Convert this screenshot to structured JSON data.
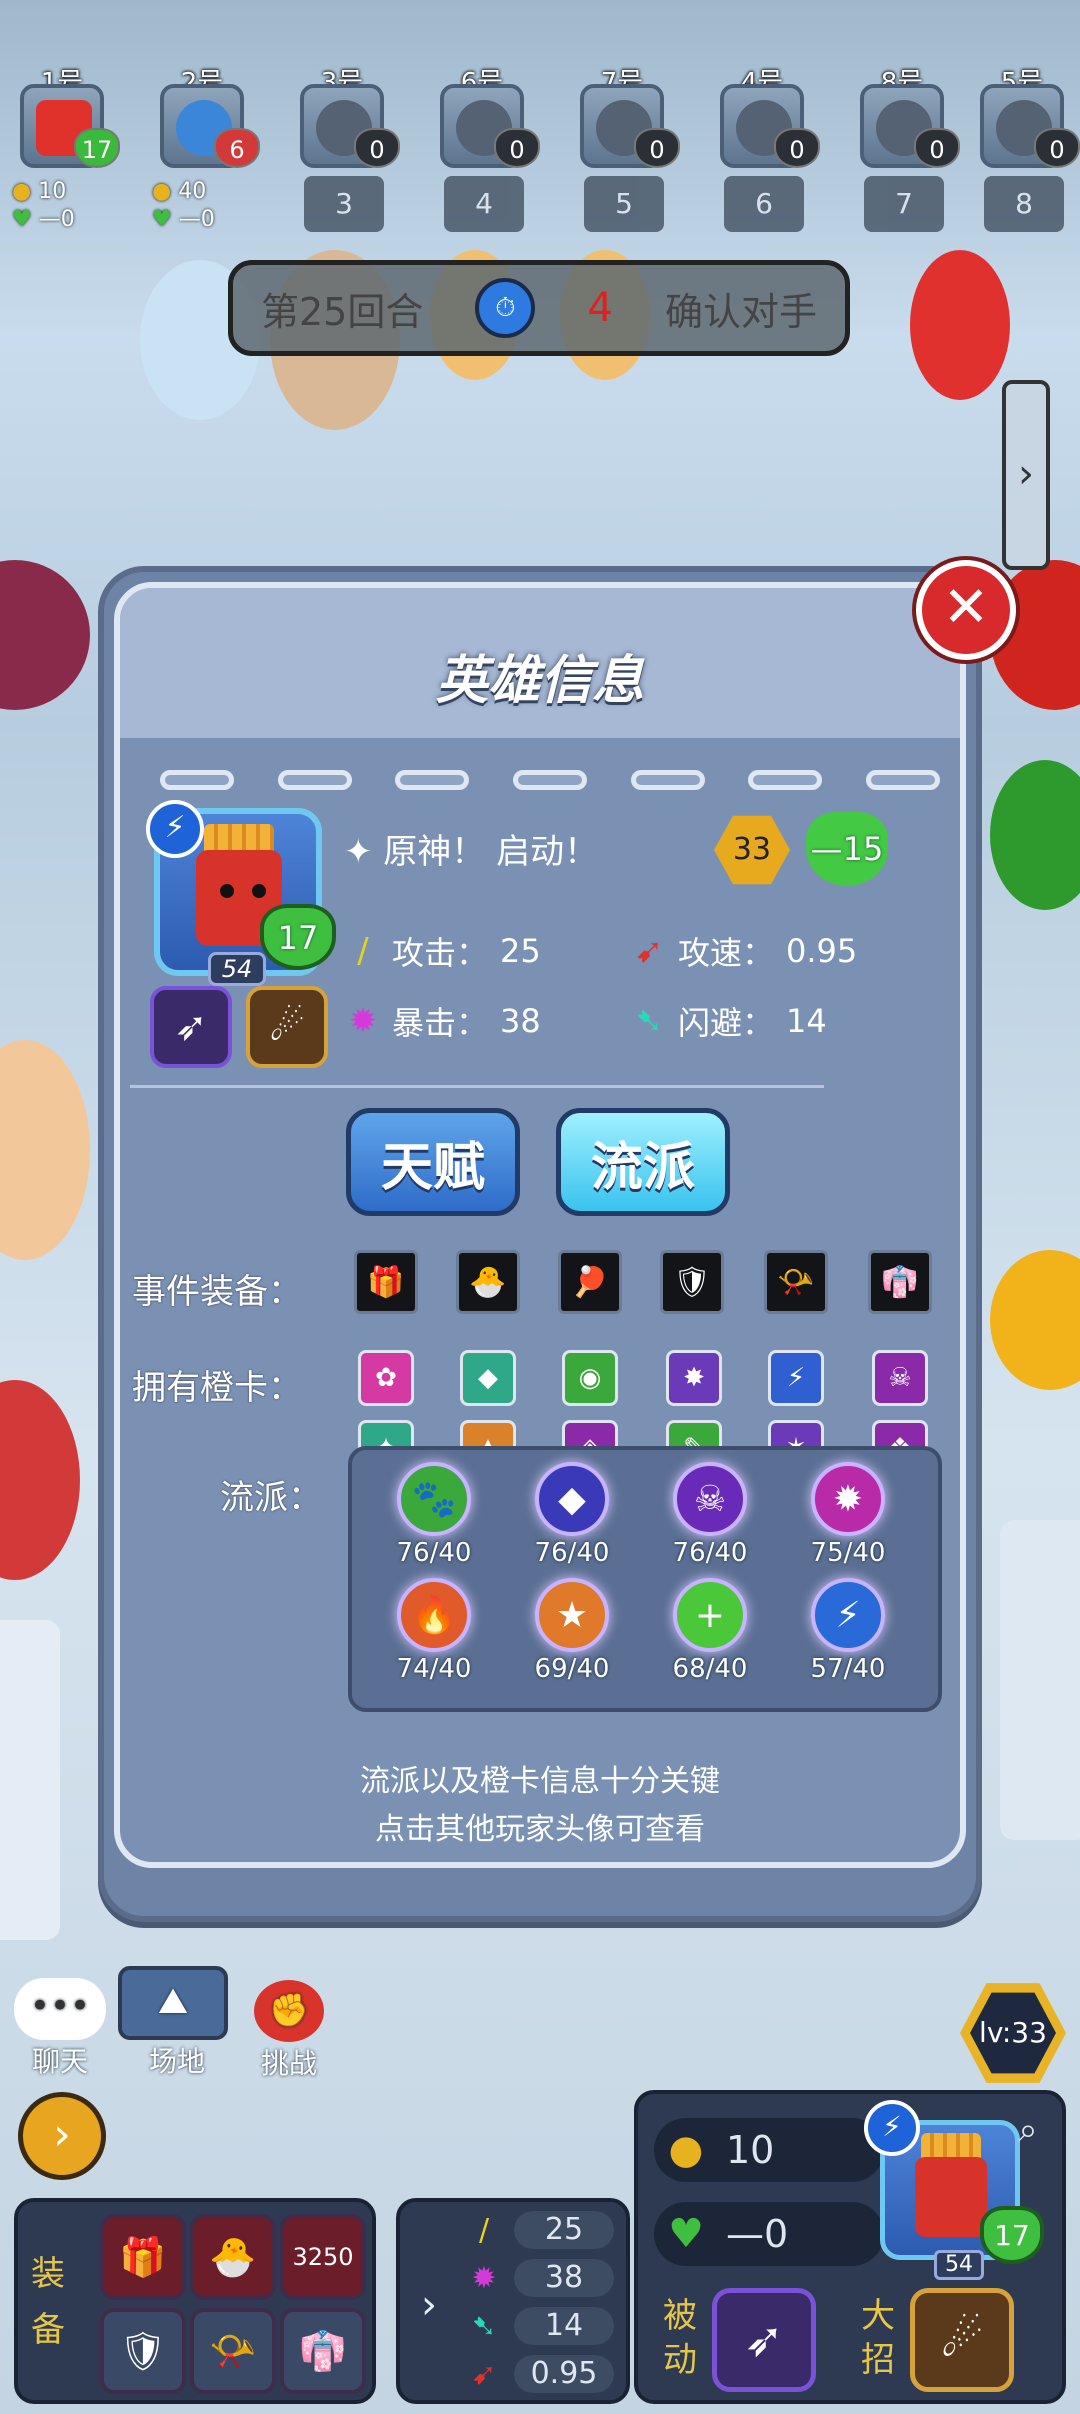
{
  "players": [
    {
      "num": "1号",
      "hp": "17",
      "rank": "",
      "gold": "10",
      "hpdelta": "—0",
      "avatar": "fries",
      "heart": "green"
    },
    {
      "num": "2号",
      "hp": "6",
      "rank": "",
      "gold": "40",
      "hpdelta": "—0",
      "avatar": "blue",
      "heart": "red"
    },
    {
      "num": "3号",
      "hp": "0",
      "rank": "3",
      "heart": "dark"
    },
    {
      "num": "6号",
      "hp": "0",
      "rank": "4",
      "heart": "dark"
    },
    {
      "num": "7号",
      "hp": "0",
      "rank": "5",
      "heart": "dark"
    },
    {
      "num": "4号",
      "hp": "0",
      "rank": "6",
      "heart": "dark"
    },
    {
      "num": "8号",
      "hp": "0",
      "rank": "7",
      "heart": "dark"
    },
    {
      "num": "5号",
      "hp": "0",
      "rank": "8",
      "heart": "dark"
    }
  ],
  "round": {
    "label": "第25回合",
    "countdown": "4",
    "status": "确认对手"
  },
  "panel": {
    "title": "英雄信息",
    "hero": {
      "name": "原神！ 启动！",
      "level": "54",
      "hp": "17",
      "gold": "33",
      "hp_change": "—15",
      "stats": {
        "attack_label": "攻击：",
        "attack": "25",
        "aspeed_label": "攻速：",
        "aspeed": "0.95",
        "crit_label": "暴击：",
        "crit": "38",
        "dodge_label": "闪避：",
        "dodge": "14"
      }
    },
    "tabs": {
      "talent": "天赋",
      "school": "流派"
    },
    "rows": {
      "equipment": "事件装备：",
      "orange": "拥有橙卡：",
      "school": "流派："
    },
    "equipment_icons": [
      "gift-icon",
      "pet-icon",
      "racket-icon",
      "armor-icon",
      "horn-icon",
      "robe-icon"
    ],
    "orange_cards": [
      {
        "icon": "✿",
        "color": "#d43aa2"
      },
      {
        "icon": "◆",
        "color": "#2fa88a"
      },
      {
        "icon": "◉",
        "color": "#3aa83a"
      },
      {
        "icon": "✸",
        "color": "#6a3ab8"
      },
      {
        "icon": "⚡",
        "color": "#2f5fd0"
      },
      {
        "icon": "☠",
        "color": "#8a2aa8"
      },
      {
        "icon": "✦",
        "color": "#2fa88a"
      },
      {
        "icon": "▲",
        "color": "#d9822a"
      },
      {
        "icon": "◈",
        "color": "#8a2aa8"
      },
      {
        "icon": "✎",
        "color": "#3aa83a"
      },
      {
        "icon": "✶",
        "color": "#6a3ab8"
      },
      {
        "icon": "❖",
        "color": "#8a2aa8"
      }
    ],
    "schools": [
      {
        "icon": "🐾",
        "value": "76/40",
        "color": "#3aa83a"
      },
      {
        "icon": "◆",
        "value": "76/40",
        "color": "#3a3ab8"
      },
      {
        "icon": "☠",
        "value": "76/40",
        "color": "#6a2ab8"
      },
      {
        "icon": "✹",
        "value": "75/40",
        "color": "#b82aa8"
      },
      {
        "icon": "🔥",
        "value": "74/40",
        "color": "#e05a2a"
      },
      {
        "icon": "★",
        "value": "69/40",
        "color": "#e07a2a"
      },
      {
        "icon": "+",
        "value": "68/40",
        "color": "#4ac83a"
      },
      {
        "icon": "⚡",
        "value": "57/40",
        "color": "#2a6ad8"
      }
    ],
    "tip_line1": "流派以及橙卡信息十分关键",
    "tip_line2": "点击其他玩家头像可查看"
  },
  "bottom": {
    "chat": "聊天",
    "field": "场地",
    "challenge": "挑战",
    "level": "lv:33",
    "equip_label": "装备",
    "equip_counter": "3250",
    "stats": {
      "attack": "25",
      "crit": "38",
      "dodge": "14",
      "aspeed": "0.95"
    },
    "gold": "10",
    "hp_change": "—0",
    "passive": "被动",
    "ultimate": "大招",
    "hero_level": "54",
    "hero_hp": "17"
  }
}
